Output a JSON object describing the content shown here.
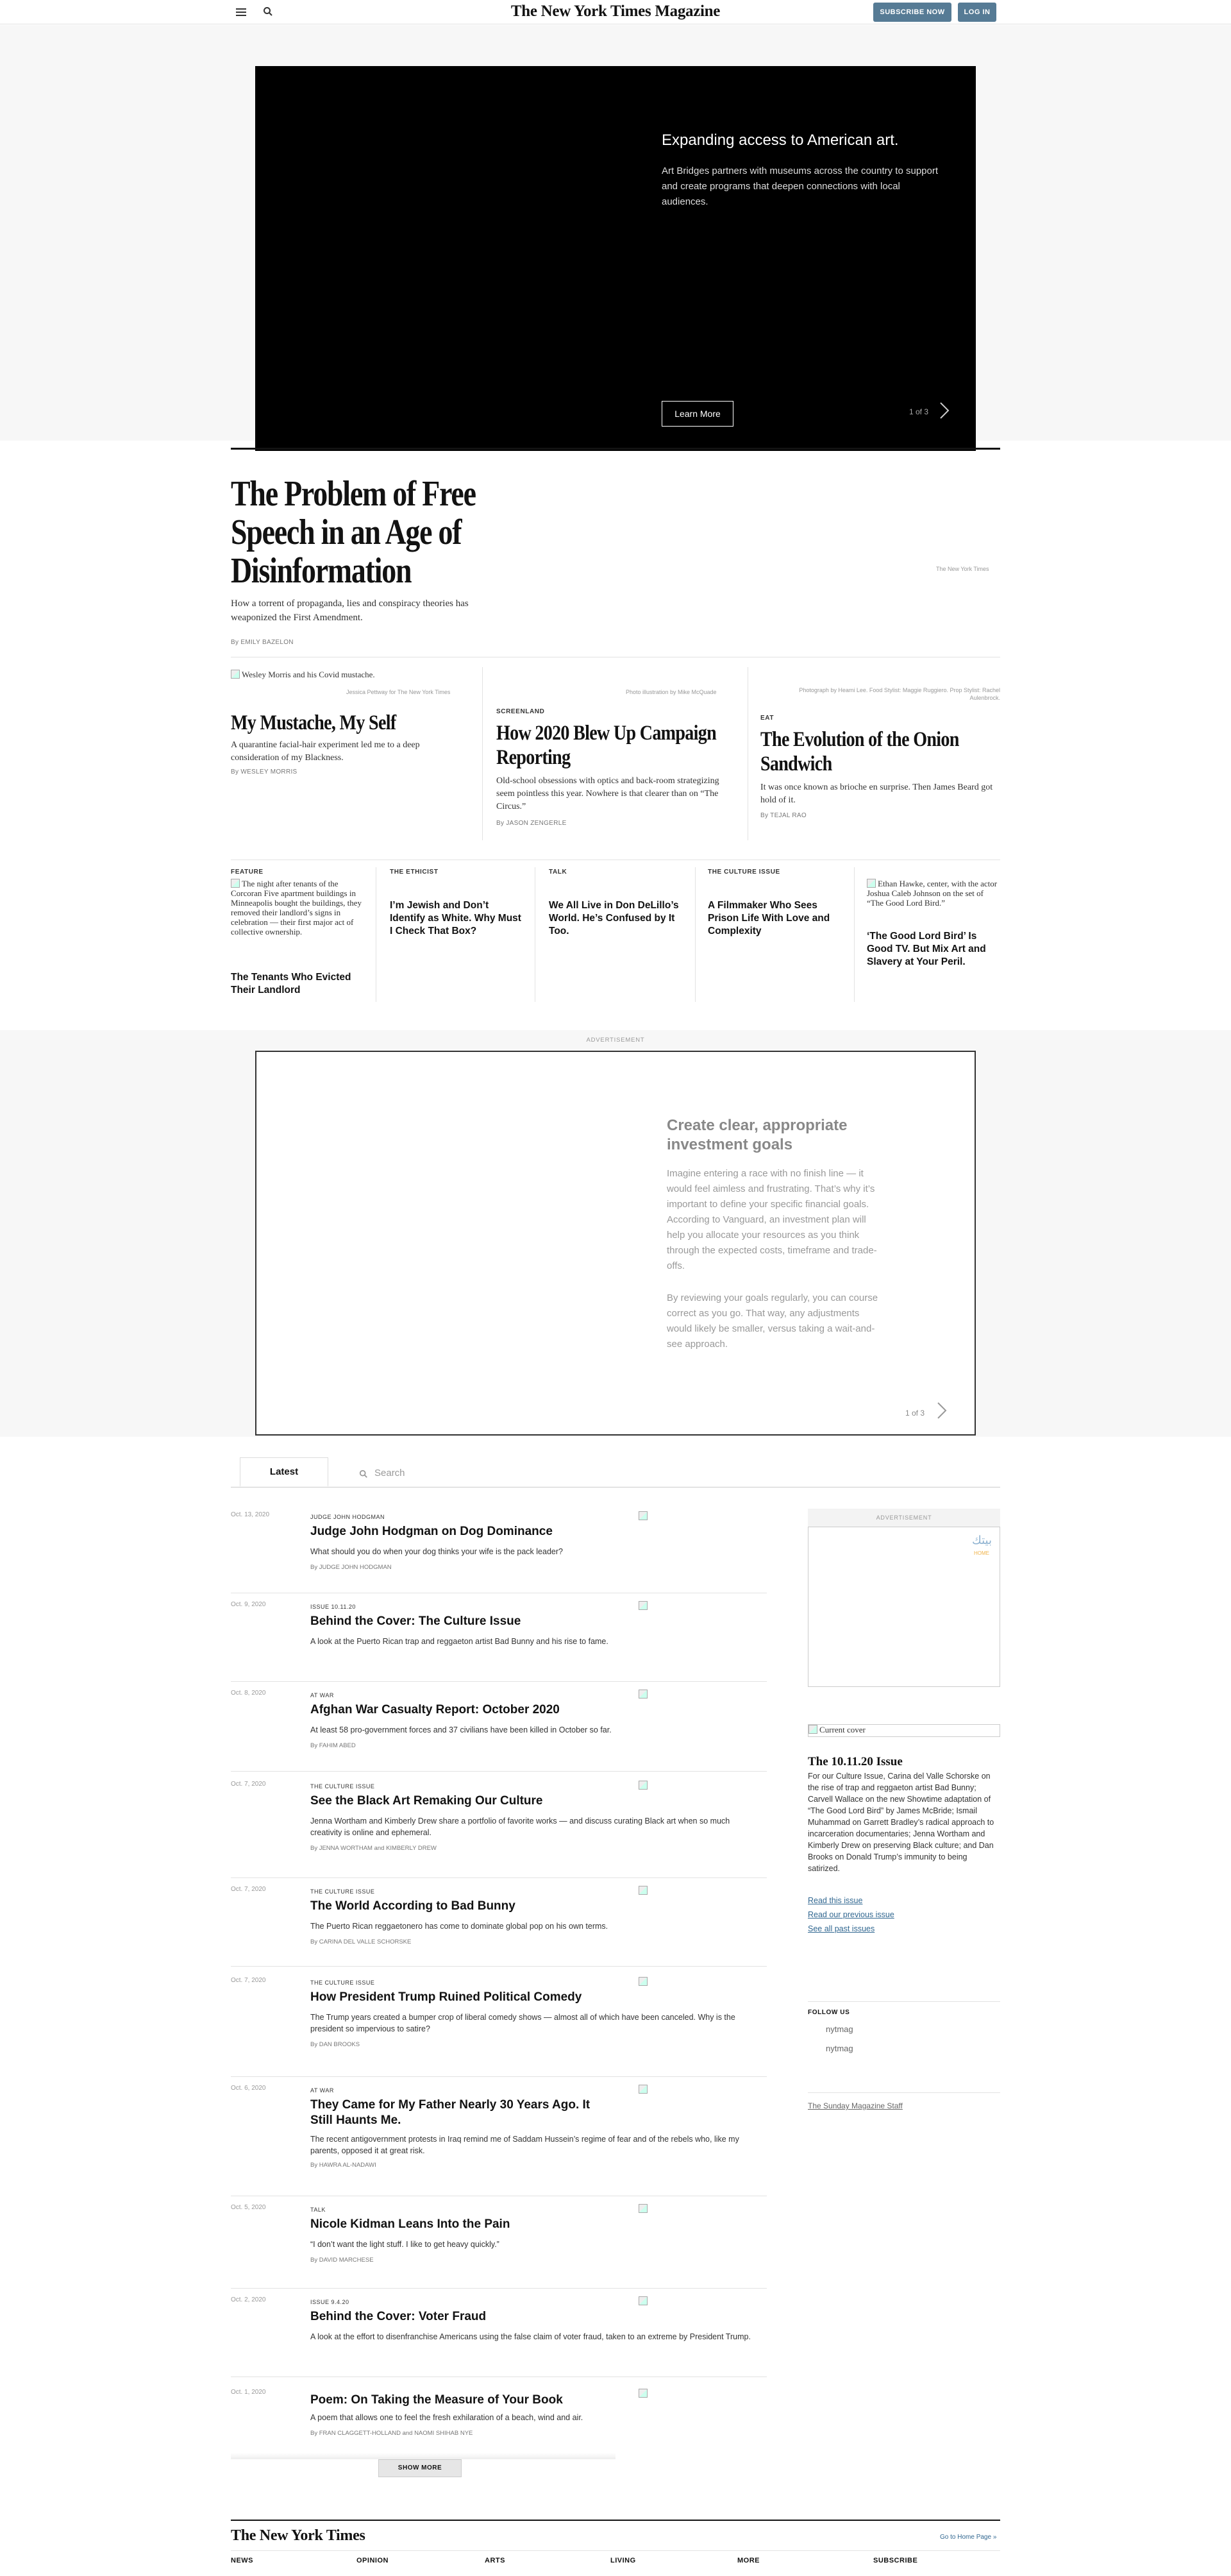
{
  "header": {
    "masthead": "The New York Times Magazine",
    "subscribe": "SUBSCRIBE NOW",
    "login": "LOG IN"
  },
  "ad_top": {
    "headline": "Expanding access to American art.",
    "body": "Art Bridges partners with museums across the country to support and create programs that deepen connections with local audiences.",
    "cta": "Learn More",
    "pager": "1 of 3"
  },
  "lead": {
    "title_l1": "The Problem of Free",
    "title_l2": "Speech in an Age of",
    "title_l3": "Disinformation",
    "summary": "How a torrent of propaganda, lies and conspiracy theories has weaponized the First Amendment.",
    "byline": "By EMILY BAZELON",
    "credit": "The New York Times"
  },
  "row2": [
    {
      "img_alt": "Wesley Morris and his Covid mustache.",
      "credit": "Jessica Pettway for The New York Times",
      "kicker": "",
      "title": "My Mustache, My Self",
      "summary": "A quarantine facial-hair experiment led me to a deep consideration of my Blackness.",
      "byline": "By WESLEY MORRIS"
    },
    {
      "img_alt": "",
      "credit": "Photo illustration by Mike McQuade",
      "kicker": "SCREENLAND",
      "title": "How 2020 Blew Up Campaign Reporting",
      "summary": "Old-school obsessions with optics and back-room strategizing seem pointless this year. Nowhere is that clearer than on “The Circus.”",
      "byline": "By JASON ZENGERLE"
    },
    {
      "img_alt": "",
      "credit": "Photograph by Heami Lee. Food Stylist: Maggie Ruggiero. Prop Stylist: Rachel Aulenbrock.",
      "kicker": "EAT",
      "title": "The Evolution of the Onion Sandwich",
      "summary": "It was once known as brioche en surprise. Then James Beard got hold of it.",
      "byline": "By TEJAL RAO"
    }
  ],
  "row3": [
    {
      "kicker": "FEATURE",
      "img_alt": "The night after tenants of the Corcoran Five apartment buildings in Minneapolis bought the buildings, they removed their landlord’s signs in celebration — their first major act of collective ownership.",
      "title": "The Tenants Who Evicted Their Landlord"
    },
    {
      "kicker": "THE ETHICIST",
      "img_alt": "",
      "title": "I’m Jewish and Don’t Identify as White. Why Must I Check That Box?"
    },
    {
      "kicker": "TALK",
      "img_alt": "",
      "title": "We All Live in Don DeLillo’s World. He’s Confused by It Too."
    },
    {
      "kicker": "THE CULTURE ISSUE",
      "img_alt": "",
      "title": "A Filmmaker Who Sees Prison Life With Love and Complexity"
    },
    {
      "kicker": "",
      "img_alt": "Ethan Hawke, center, with the actor Joshua Caleb Johnson on the set of “The Good Lord Bird.”",
      "title": "‘The Good Lord Bird’ Is Good TV. But Mix Art and Slavery at Your Peril."
    }
  ],
  "ad_mid": {
    "label": "ADVERTISEMENT",
    "headline": "Create clear, appropriate investment goals",
    "p1": "Imagine entering a race with no finish line — it would feel aimless and frustrating. That’s why it’s important to define your specific financial goals. According to Vanguard, an investment plan will help you allocate your resources as you think through the expected costs, timeframe and trade-offs.",
    "p2": "By reviewing your goals regularly, you can course correct as you go. That way, any adjustments would likely be smaller, versus taking a wait-and-see approach.",
    "pager": "1 of 3"
  },
  "latest": {
    "tab": "Latest",
    "search_placeholder": "Search",
    "show_more": "SHOW MORE",
    "stories": [
      {
        "date": "Oct. 13, 2020",
        "kicker": "JUDGE JOHN HODGMAN",
        "title": "Judge John Hodgman on Dog Dominance",
        "summary": "What should you do when your dog thinks your wife is the pack leader?",
        "byline": "By JUDGE JOHN HODGMAN"
      },
      {
        "date": "Oct. 9, 2020",
        "kicker": "ISSUE 10.11.20",
        "title": "Behind the Cover: The Culture Issue",
        "summary": "A look at the Puerto Rican trap and reggaeton artist Bad Bunny and his rise to fame.",
        "byline": ""
      },
      {
        "date": "Oct. 8, 2020",
        "kicker": "AT WAR",
        "title": "Afghan War Casualty Report: October 2020",
        "summary": "At least 58 pro-government forces and 37 civilians have been killed in October so far.",
        "byline": "By FAHIM ABED"
      },
      {
        "date": "Oct. 7, 2020",
        "kicker": "THE CULTURE ISSUE",
        "title": "See the Black Art Remaking Our Culture",
        "summary": "Jenna Wortham and Kimberly Drew share a portfolio of favorite works — and discuss curating Black art when so much creativity is online and ephemeral.",
        "byline": "By JENNA WORTHAM and KIMBERLY DREW"
      },
      {
        "date": "Oct. 7, 2020",
        "kicker": "THE CULTURE ISSUE",
        "title": "The World According to Bad Bunny",
        "summary": "The Puerto Rican reggaetonero has come to dominate global pop on his own terms.",
        "byline": "By CARINA DEL VALLE SCHORSKE"
      },
      {
        "date": "Oct. 7, 2020",
        "kicker": "THE CULTURE ISSUE",
        "title": "How President Trump Ruined Political Comedy",
        "summary": "The Trump years created a bumper crop of liberal comedy shows — almost all of which have been canceled. Why is the president so impervious to satire?",
        "byline": "By DAN BROOKS"
      },
      {
        "date": "Oct. 6, 2020",
        "kicker": "AT WAR",
        "title": "They Came for My Father Nearly 30 Years Ago. It Still Haunts Me.",
        "summary": "The recent antigovernment protests in Iraq remind me of Saddam Hussein’s regime of fear and of the rebels who, like my parents, opposed it at great risk.",
        "byline": "By HAWRA AL-NADAWI"
      },
      {
        "date": "Oct. 5, 2020",
        "kicker": "TALK",
        "title": "Nicole Kidman Leans Into the Pain",
        "summary": "“I don’t want the light stuff. I like to get heavy quickly.”",
        "byline": "By DAVID MARCHESE"
      },
      {
        "date": "Oct. 2, 2020",
        "kicker": "ISSUE 9.4.20",
        "title": "Behind the Cover: Voter Fraud",
        "summary": "A look at the effort to disenfranchise Americans using the false claim of voter fraud, taken to an extreme by President Trump.",
        "byline": ""
      },
      {
        "date": "Oct. 1, 2020",
        "kicker": "",
        "title": "Poem: On Taking the Measure of Your Book",
        "summary": "A poem that allows one to feel the fresh exhilaration of a beach, wind and air.",
        "byline": "By FRAN CLAGGETT-HOLLAND and NAOMI SHIHAB NYE"
      }
    ]
  },
  "sidebar": {
    "ad_label": "ADVERTISEMENT",
    "ad_logo": "بيتك",
    "ad_logo_sub": "HOME",
    "cover_alt": "Current cover",
    "issue_title": "The 10.11.20 Issue",
    "issue_text": "For our Culture Issue, Carina del Valle Schorske on the rise of trap and reggaeton artist Bad Bunny; Carvell Wallace on the new Showtime adaptation of “The Good Lord Bird” by James McBride; Ismail Muhammad on Garrett Bradley’s radical approach to incarceration documentaries; Jenna Wortham and Kimberly Drew on preserving Black culture; and Dan Brooks on Donald Trump’s immunity to being satirized.",
    "read_issue": "Read this issue",
    "read_prev": "Read our previous issue",
    "see_all": "See all past issues",
    "follow": "FOLLOW US",
    "social1": "nytmag",
    "social2": "nytmag",
    "staff": "The Sunday Magazine Staff"
  },
  "footer": {
    "logo": "The New York Times",
    "home": "Go to Home Page »",
    "cols": [
      "NEWS",
      "OPINION",
      "ARTS",
      "LIVING",
      "MORE",
      "SUBSCRIBE"
    ]
  }
}
